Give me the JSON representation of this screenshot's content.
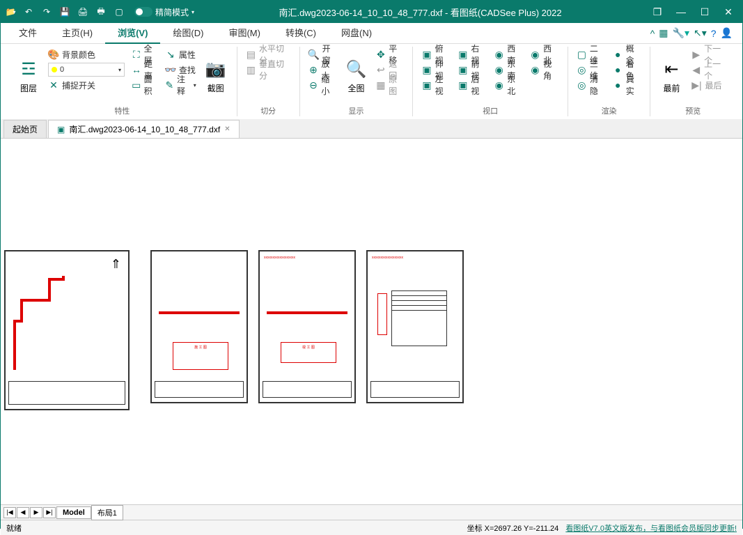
{
  "titlebar": {
    "mode_label": "精简模式",
    "title": "南汇.dwg2023-06-14_10_10_48_777.dxf - 看图纸(CADSee Plus) 2022"
  },
  "menu": {
    "file": "文件",
    "home": "主页(H)",
    "view": "浏览(V)",
    "draw": "绘图(D)",
    "review": "审图(M)",
    "convert": "转换(C)",
    "cloud": "网盘(N)"
  },
  "ribbon": {
    "layer": "图层",
    "bg_color": "背景颜色",
    "layer0": "0",
    "snap": "捕捉开关",
    "fullscreen": "全屏",
    "distance": "距离",
    "area": "面积",
    "properties": "属性",
    "find": "查找",
    "annotate": "注释",
    "screenshot": "截图",
    "hsplit": "水平切分",
    "vsplit": "垂直切分",
    "window": "开窗",
    "zoomin": "放大",
    "zoomout": "缩小",
    "full": "全图",
    "pan": "平移",
    "back": "返回",
    "original": "原图",
    "top": "俯视",
    "bottom": "仰视",
    "left": "左视",
    "right": "右视",
    "front": "前视",
    "rear": "后视",
    "sw": "西南",
    "se": "东南",
    "ne": "东北",
    "nw": "西北",
    "angle": "视角",
    "d2": "二维",
    "d3": "三维",
    "hide": "消隐",
    "concept": "概念",
    "shade": "着色",
    "real": "真实",
    "front_nav": "最前",
    "next": "下一个",
    "prev": "上一个",
    "last": "最后",
    "g_props": "特性",
    "g_split": "切分",
    "g_display": "显示",
    "g_viewport": "视口",
    "g_render": "渲染",
    "g_preview": "预览"
  },
  "doctabs": {
    "start": "起始页",
    "doc1": "南汇.dwg2023-06-14_10_10_48_777.dxf"
  },
  "bottombar": {
    "model": "Model",
    "layout1": "布局1"
  },
  "statusbar": {
    "ready": "就绪",
    "coords": "坐标 X=2697.26 Y=-211.24",
    "promo": "看图纸V7.0英文版发布，与看图纸会员版同步更新!"
  }
}
